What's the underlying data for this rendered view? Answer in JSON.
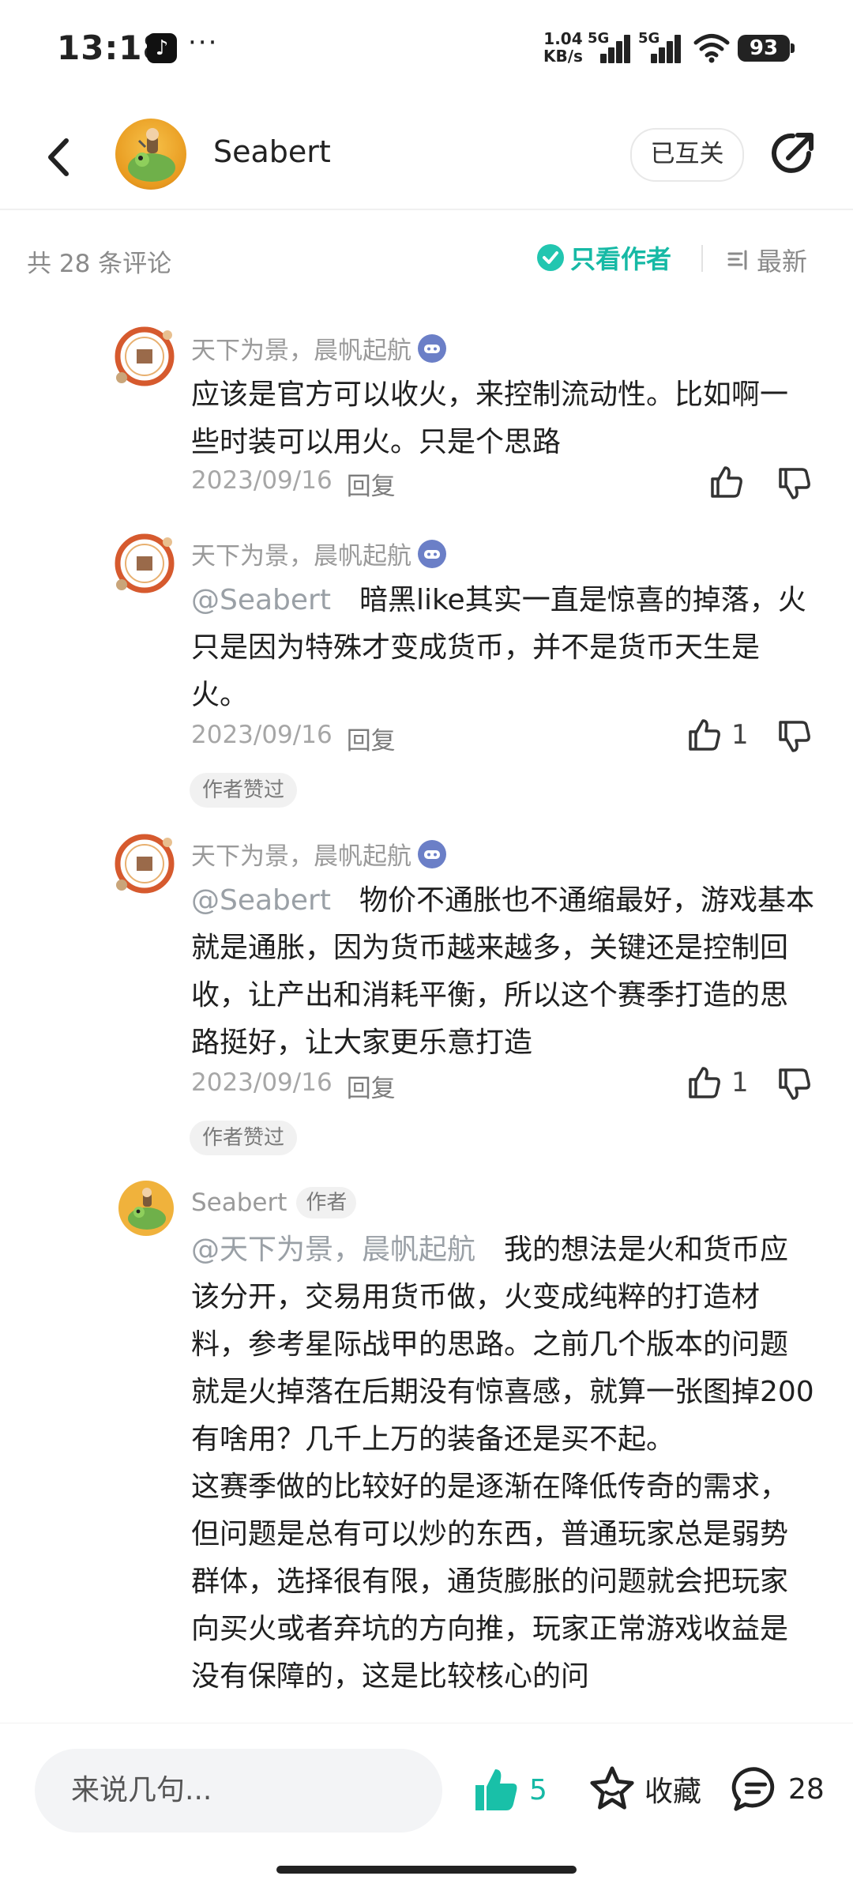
{
  "status_bar": {
    "time": "13:18",
    "net_speed_value": "1.04",
    "net_speed_unit": "KB/s",
    "signal1_tag": "5G",
    "signal2_tag": "5G",
    "battery": "93"
  },
  "header": {
    "username": "Seabert",
    "follow_label": "已互关"
  },
  "comments_bar": {
    "count_label": "共 28 条评论",
    "author_only_label": "只看作者",
    "sort_label": "最新"
  },
  "comments": [
    {
      "user": "天下为景，晨帆起航",
      "text": "应该是官方可以收火，来控制流动性。比如啊一些时装可以用火。只是个思路",
      "date": "2023/09/16",
      "reply_label": "回复",
      "likes": ""
    },
    {
      "user": "天下为景，晨帆起航",
      "mention": "@Seabert",
      "text": "暗黑like其实一直是惊喜的掉落，火只是因为特殊才变成货币，并不是货币天生是火。",
      "date": "2023/09/16",
      "reply_label": "回复",
      "likes": "1",
      "praise_tag": "作者赞过"
    },
    {
      "user": "天下为景，晨帆起航",
      "mention": "@Seabert",
      "text": "物价不通胀也不通缩最好，游戏基本就是通胀，因为货币越来越多，关键还是控制回收，让产出和消耗平衡，所以这个赛季打造的思路挺好，让大家更乐意打造",
      "date": "2023/09/16",
      "reply_label": "回复",
      "likes": "1",
      "praise_tag": "作者赞过"
    },
    {
      "user": "Seabert",
      "author_tag": "作者",
      "mention": "@天下为景，晨帆起航",
      "text1": "我的想法是火和货币应该分开，交易用货币做，火变成纯粹的打造材料，参考星际战甲的思路。之前几个版本的问题就是火掉落在后期没有惊喜感，就算一张图掉200有啥用？几千上万的装备还是买不起。",
      "text2": "这赛季做的比较好的是逐渐在降低传奇的需求，但问题是总有可以炒的东西，普通玩家总是弱势群体，选择很有限，通货膨胀的问题就会把玩家向买火或者弃坑的方向推，玩家正常游戏收益是没有保障的，这是比较核心的问"
    }
  ],
  "bottom_bar": {
    "input_placeholder": "来说几句...",
    "like_count": "5",
    "favorite_label": "收藏",
    "comment_count": "28"
  },
  "colors": {
    "accent": "#16b9a5",
    "muted_text": "#9a9a9a"
  }
}
